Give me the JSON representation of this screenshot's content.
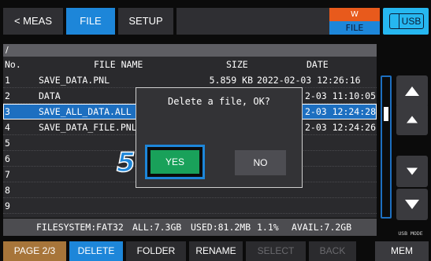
{
  "tabs": {
    "meas": "< MEAS",
    "file": "FILE",
    "setup": "SETUP"
  },
  "status": {
    "top": "W",
    "bottom": "FILE",
    "usb": "USB"
  },
  "file_list": {
    "path": "/",
    "headers": {
      "no": "No.",
      "name": "FILE NAME",
      "size": "SIZE",
      "date": "DATE"
    },
    "rows": [
      {
        "no": "1",
        "name": "SAVE_DATA.PNL",
        "size": "5.859 KB",
        "date": "2022-02-03 12:26:16"
      },
      {
        "no": "2",
        "name": "DATA",
        "size": "",
        "date": "2-03 11:10:05"
      },
      {
        "no": "3",
        "name": "SAVE_ALL_DATA.ALL",
        "size": "",
        "date": "2-03 12:24:28"
      },
      {
        "no": "4",
        "name": "SAVE_DATA_FILE.PNL",
        "size": "",
        "date": "2-03 12:24:26"
      },
      {
        "no": "5",
        "name": "",
        "size": "",
        "date": ""
      },
      {
        "no": "6",
        "name": "",
        "size": "",
        "date": ""
      },
      {
        "no": "7",
        "name": "",
        "size": "",
        "date": ""
      },
      {
        "no": "8",
        "name": "",
        "size": "",
        "date": ""
      },
      {
        "no": "9",
        "name": "",
        "size": "",
        "date": ""
      }
    ],
    "selected_index": 2,
    "filesystem": {
      "fs": "FILESYSTEM:FAT32",
      "all": "ALL:7.3GB",
      "used": "USED:81.2MB",
      "pct": "1.1%",
      "avail": "AVAIL:7.2GB"
    }
  },
  "dialog": {
    "message": "Delete a file, OK?",
    "yes": "YES",
    "no": "NO",
    "step": "5"
  },
  "usb_mode_label": "USB MODE",
  "bottom_bar": {
    "page": "PAGE 2/3",
    "delete": "DELETE",
    "folder": "FOLDER",
    "rename": "RENAME",
    "select": "SELECT",
    "back": "BACK",
    "mem": "MEM"
  },
  "colors": {
    "accent_blue": "#1d86d9",
    "status_orange": "#e85a1c",
    "usb_cyan": "#26b7f0",
    "yes_green": "#19a15a",
    "page_brown": "#a7753a"
  }
}
